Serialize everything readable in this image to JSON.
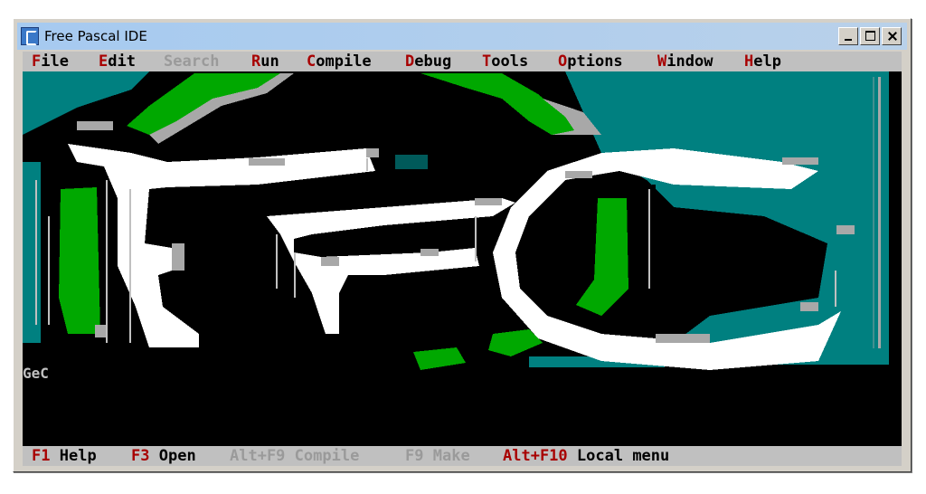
{
  "window": {
    "title": "Free Pascal IDE"
  },
  "menu": [
    {
      "hotkey": "F",
      "rest": "ile",
      "enabled": true
    },
    {
      "hotkey": "E",
      "rest": "dit",
      "enabled": true
    },
    {
      "hotkey": "S",
      "rest": "earch",
      "enabled": false
    },
    {
      "hotkey": "R",
      "rest": "un",
      "enabled": true
    },
    {
      "hotkey": "C",
      "rest": "ompile",
      "enabled": true
    },
    {
      "hotkey": "D",
      "rest": "ebug",
      "enabled": true
    },
    {
      "hotkey": "T",
      "rest": "ools",
      "enabled": true
    },
    {
      "hotkey": "O",
      "rest": "ptions",
      "enabled": true
    },
    {
      "hotkey": "W",
      "rest": "indow",
      "enabled": true
    },
    {
      "hotkey": "H",
      "rest": "elp",
      "enabled": true
    }
  ],
  "desktop": {
    "logo_caption": "GeC"
  },
  "status": [
    {
      "key": "F1",
      "label": "Help",
      "enabled": true
    },
    {
      "key": "F3",
      "label": "Open",
      "enabled": true
    },
    {
      "key": "Alt+F9",
      "label": "Compile",
      "enabled": false
    },
    {
      "key": "F9",
      "label": "Make",
      "enabled": false
    },
    {
      "key": "Alt+F10",
      "label": "Local menu",
      "enabled": true
    }
  ],
  "colors": {
    "desktop_bg": "#000000",
    "teal": "#008080",
    "green": "#00a800",
    "white": "#ffffff",
    "gray": "#a8a8a8",
    "hotkey_red": "#a80000"
  }
}
